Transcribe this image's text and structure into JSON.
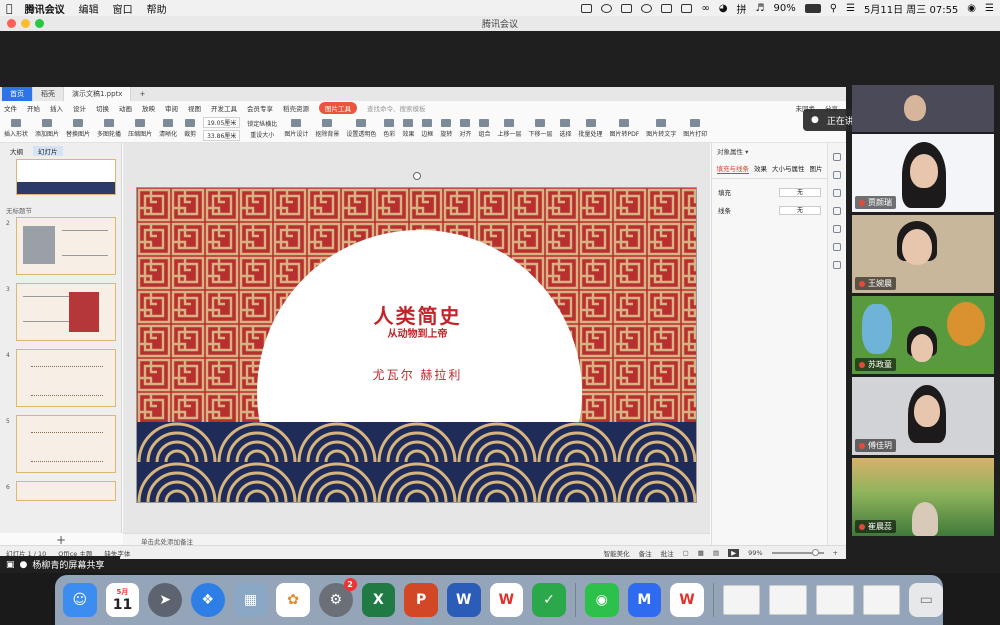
{
  "menubar": {
    "app_name": "腾讯会议",
    "items": [
      "编辑",
      "窗口",
      "帮助"
    ],
    "battery": "90%",
    "datetime": "5月11日 周三  07:55",
    "input_method": "拼"
  },
  "window": {
    "title": "腾讯会议"
  },
  "wps": {
    "tabs": [
      "首页",
      "稻壳",
      "演示文稿1.pptx"
    ],
    "menu_items": [
      "文件",
      "开始",
      "插入",
      "设计",
      "切换",
      "动画",
      "放映",
      "审阅",
      "视图",
      "开发工具",
      "会员专享",
      "稻壳资源"
    ],
    "active_menu": "图片工具",
    "search_placeholder": "查找命令、搜索模板",
    "share_label": "未同步",
    "share_button": "分享",
    "ribbon": {
      "insert_image": "插入形状",
      "add_image": "添加图片",
      "multi_image": "多图轮播",
      "replace": "替换图片",
      "batch": "图片拼图",
      "compress": "压缩图片",
      "sharpen": "清晰化",
      "crop": "裁剪",
      "height": "19.05厘米",
      "width": "33.86厘米",
      "lock_ratio": "锁定纵横比",
      "reset_size": "重设大小",
      "design": "图片设计",
      "bg": "抠除背景",
      "transparent": "设置透明色",
      "color": "色彩",
      "effect": "效果",
      "border": "边框",
      "combine": "组合",
      "up": "上移一层",
      "down": "下移一层",
      "select": "选择",
      "batch_proc": "批量处理",
      "to_pdf": "图片转PDF",
      "to_text": "图片转文字",
      "translate": "图片翻译",
      "print": "图片打印",
      "rotate": "旋转",
      "align": "对齐"
    },
    "left_tabs": [
      "大纲",
      "幻灯片"
    ],
    "section_label": "无标题节",
    "slide_numbers": [
      "2",
      "3",
      "4",
      "5",
      "6"
    ],
    "slide": {
      "title": "人类简史",
      "subtitle": "从动物到上帝",
      "author": "尤瓦尔  赫拉利"
    },
    "notes_placeholder": "单击此处添加备注",
    "right_pane": {
      "title": "对象属性 ▾",
      "tabs": [
        "填充与线条",
        "效果",
        "大小与属性",
        "图片"
      ],
      "fill_label": "填充",
      "line_label": "线条",
      "fill_value": "无",
      "line_value": "无"
    },
    "status": {
      "slide_pos": "幻灯片 1 / 10",
      "theme": "Office 主题",
      "font_missing": "缺失字体",
      "smart_beautify": "智能美化",
      "notes": "备注",
      "comment": "批注",
      "zoom": "99%"
    }
  },
  "meeting": {
    "speaking_text": "正在讲话: 杨柳青; 陈迪;",
    "participants": [
      "贾颜瑞",
      "王婉晨",
      "苏政童",
      "傅佳玥",
      "崔晨蕊"
    ],
    "share_text": "杨柳青的屏幕共享"
  },
  "dock": {
    "calendar_month": "5月",
    "calendar_day": "11",
    "settings_badge": "2"
  }
}
